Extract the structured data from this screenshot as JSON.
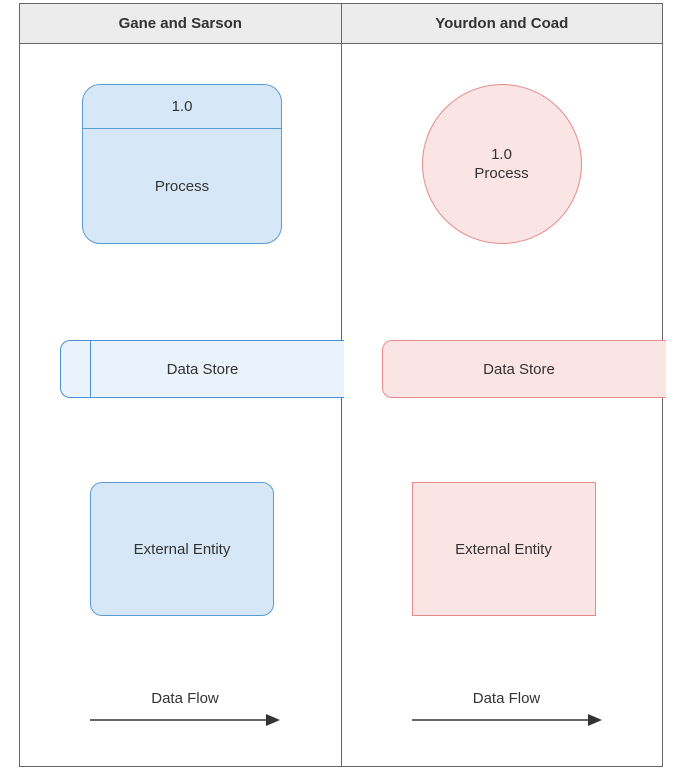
{
  "headers": {
    "left": "Gane and Sarson",
    "right": "Yourdon and Coad"
  },
  "gs": {
    "process_num": "1.0",
    "process_label": "Process",
    "datastore_label": "Data Store",
    "entity_label": "External Entity",
    "dataflow_label": "Data Flow"
  },
  "yc": {
    "process_num": "1.0",
    "process_label": "Process",
    "datastore_label": "Data Store",
    "entity_label": "External Entity",
    "dataflow_label": "Data Flow"
  },
  "chart_data": {
    "type": "table",
    "title": "DFD Notation Comparison",
    "columns": [
      "Gane and Sarson",
      "Yourdon and Coad"
    ],
    "rows": [
      {
        "element": "Process",
        "gane_sarson": "Rounded rectangle with number band (1.0) on top",
        "yourdon_coad": "Circle with number (1.0) and label inside"
      },
      {
        "element": "Data Store",
        "gane_sarson": "Open-right rectangle with left id compartment",
        "yourdon_coad": "Open-right rectangle (no compartment)"
      },
      {
        "element": "External Entity",
        "gane_sarson": "Rounded rectangle",
        "yourdon_coad": "Square-corner rectangle"
      },
      {
        "element": "Data Flow",
        "gane_sarson": "Labeled arrow",
        "yourdon_coad": "Labeled arrow"
      }
    ]
  }
}
